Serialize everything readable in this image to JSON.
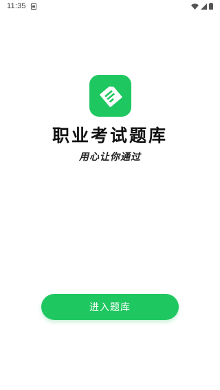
{
  "status_bar": {
    "time": "11:35",
    "icons": [
      "notification-icon",
      "wifi-icon",
      "signal-icon",
      "battery-icon"
    ]
  },
  "app": {
    "logo": "app-logo-icon",
    "title": "职业考试题库",
    "slogan": "用心让你通过"
  },
  "actions": {
    "enter_label": "进入题库"
  },
  "colors": {
    "accent": "#1fc760",
    "text": "#111111",
    "background": "#ffffff"
  }
}
